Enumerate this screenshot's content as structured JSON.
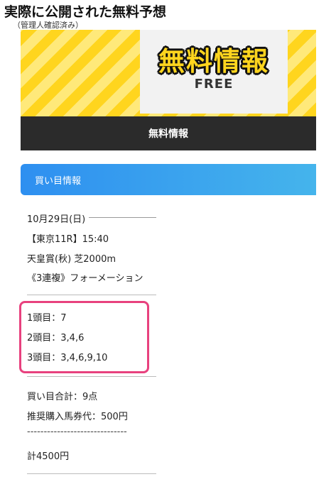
{
  "header": {
    "title": "実際に公開された無料予想",
    "subtitle": "（管理人確認済み）"
  },
  "banner": {
    "title": "無料情報",
    "subtitle": "FREE",
    "bar_label": "無料情報"
  },
  "info_bar": {
    "label": "買い目情報"
  },
  "race": {
    "date": "10月29日(日)",
    "race_info": "【東京11R】15:40",
    "race_name": "天皇賞(秋) 芝2000m",
    "bet_type": "《3連複》フォーメーション"
  },
  "formation": {
    "first": "1頭目：7",
    "second": "2頭目：3,4,6",
    "third": "3頭目：3,4,6,9,10"
  },
  "summary": {
    "total_points": "買い目合計：9点",
    "recommended": "推奨購入馬券代：500円",
    "separator": "------------------------------",
    "total": "計4500円"
  },
  "colors": {
    "stripe_yellow": "#ffd51e",
    "info_bar_blue": "#2e8ff0",
    "highlight_pink": "#e8417e",
    "dark_bar": "#2b2b2b"
  }
}
